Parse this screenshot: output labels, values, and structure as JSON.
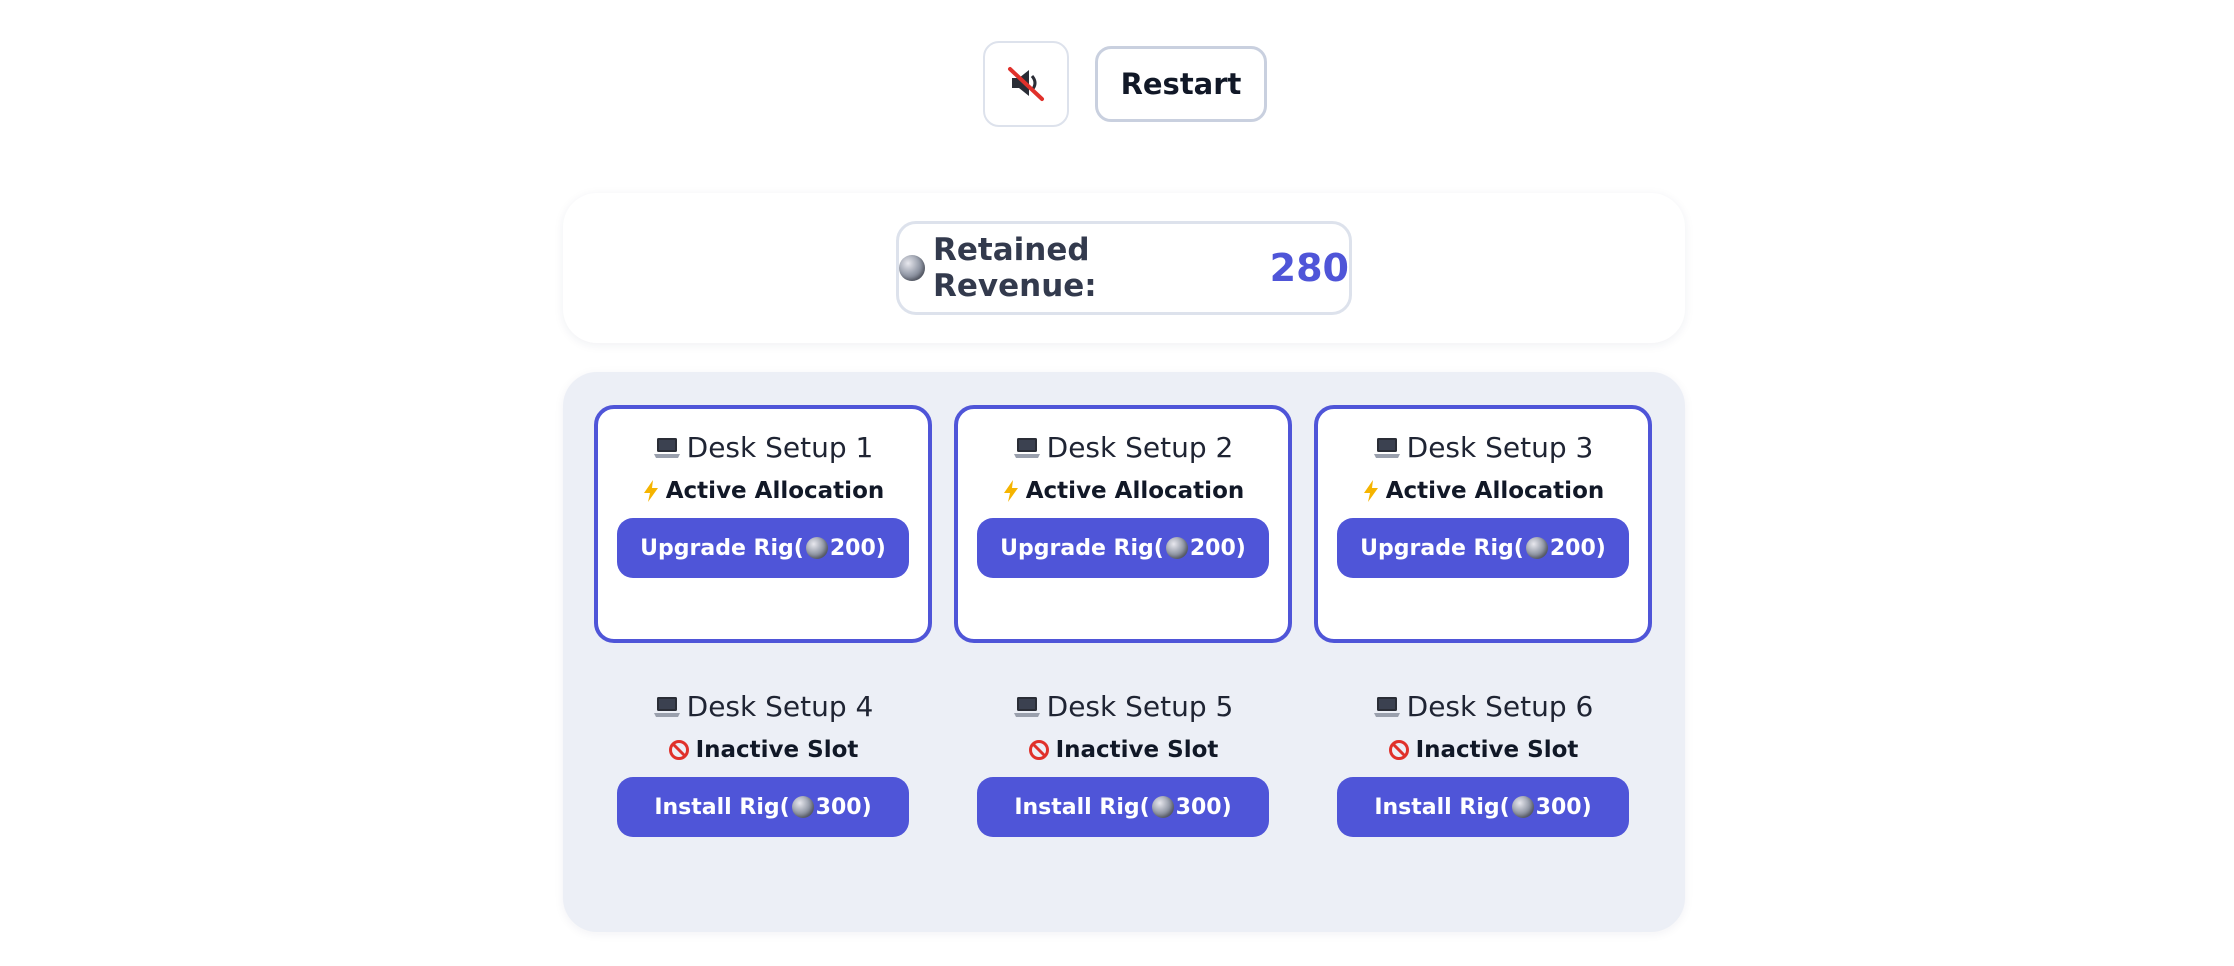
{
  "controls": {
    "sound_icon": "muted-speaker-icon",
    "restart_label": "Restart"
  },
  "revenue": {
    "icon": "coin-icon",
    "label": "Retained Revenue:",
    "value": "280"
  },
  "desks": [
    {
      "title": "Desk Setup 1",
      "status": "Active Allocation",
      "status_icon": "lightning-icon",
      "action_prefix": "Upgrade Rig(",
      "action_cost": "200",
      "action_suffix": ")",
      "active": true
    },
    {
      "title": "Desk Setup 2",
      "status": "Active Allocation",
      "status_icon": "lightning-icon",
      "action_prefix": "Upgrade Rig(",
      "action_cost": "200",
      "action_suffix": ")",
      "active": true
    },
    {
      "title": "Desk Setup 3",
      "status": "Active Allocation",
      "status_icon": "lightning-icon",
      "action_prefix": "Upgrade Rig(",
      "action_cost": "200",
      "action_suffix": ")",
      "active": true
    },
    {
      "title": "Desk Setup 4",
      "status": "Inactive Slot",
      "status_icon": "prohibited-icon",
      "action_prefix": "Install Rig(",
      "action_cost": "300",
      "action_suffix": ")",
      "active": false
    },
    {
      "title": "Desk Setup 5",
      "status": "Inactive Slot",
      "status_icon": "prohibited-icon",
      "action_prefix": "Install Rig(",
      "action_cost": "300",
      "action_suffix": ")",
      "active": false
    },
    {
      "title": "Desk Setup 6",
      "status": "Inactive Slot",
      "status_icon": "prohibited-icon",
      "action_prefix": "Install Rig(",
      "action_cost": "300",
      "action_suffix": ")",
      "active": false
    }
  ],
  "colors": {
    "accent": "#4f55d8",
    "panel_bg": "#eceff6",
    "status_ban": "#e0312b",
    "status_bolt": "#f5b400"
  }
}
